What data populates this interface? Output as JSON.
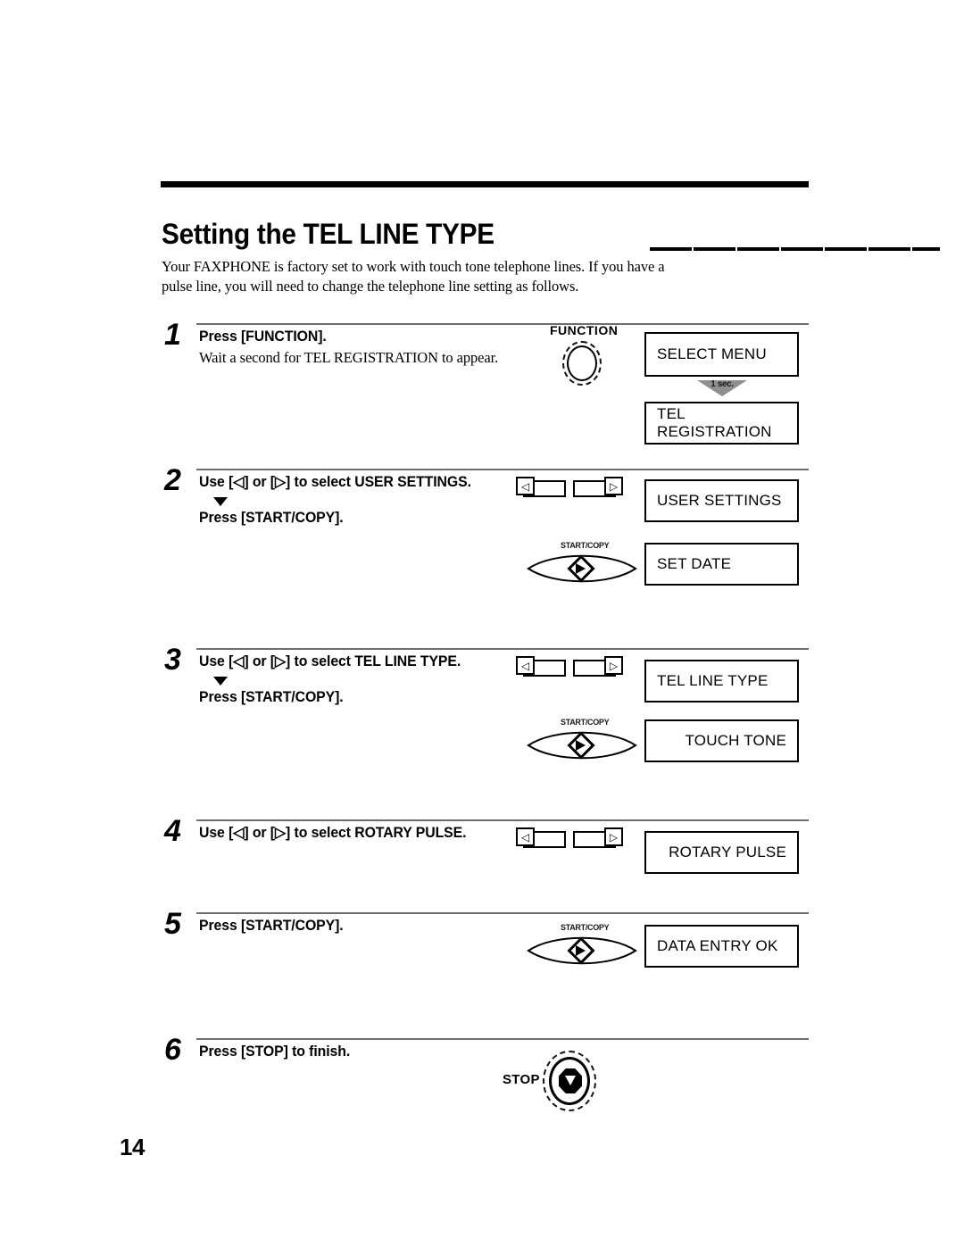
{
  "document": {
    "title": "Setting the TEL LINE TYPE",
    "intro_lines": [
      "Your FAXPHONE is factory set to work with touch tone telephone lines. If you have a",
      "pulse line, you will need to change the telephone line setting as follows."
    ],
    "page_number": "14"
  },
  "labels": {
    "function_key": "FUNCTION",
    "start_copy_key": "START/COPY",
    "stop_key": "STOP",
    "left_arrow_glyph": "◁",
    "right_arrow_glyph": "▷",
    "one_second": "1 sec."
  },
  "steps": [
    {
      "number": "1",
      "lines": [
        {
          "style": "bold",
          "text": "Press [FUNCTION]."
        },
        {
          "style": "serif",
          "text": "Wait a second for TEL REGISTRATION to appear."
        }
      ],
      "key_graphic": "function-key",
      "displays": [
        {
          "text": "SELECT MENU",
          "align": "left"
        },
        {
          "text": "TEL REGISTRATION",
          "align": "left"
        }
      ],
      "transition": "1 sec."
    },
    {
      "number": "2",
      "lines": [
        {
          "style": "bold",
          "text": "Use [◁] or [▷] to select USER SETTINGS."
        },
        {
          "style": "arrow",
          "text": ""
        },
        {
          "style": "bold",
          "text": "Press [START/COPY]."
        }
      ],
      "key_graphics": [
        "arrow-keys",
        "start-copy-key"
      ],
      "displays": [
        {
          "text": "USER SETTINGS",
          "align": "left"
        },
        {
          "text": "SET DATE",
          "align": "left"
        }
      ]
    },
    {
      "number": "3",
      "lines": [
        {
          "style": "bold",
          "text": "Use [◁] or [▷] to select TEL LINE TYPE."
        },
        {
          "style": "arrow",
          "text": ""
        },
        {
          "style": "bold",
          "text": "Press [START/COPY]."
        }
      ],
      "key_graphics": [
        "arrow-keys",
        "start-copy-key"
      ],
      "displays": [
        {
          "text": "TEL LINE TYPE",
          "align": "left"
        },
        {
          "text": "TOUCH TONE",
          "align": "right"
        }
      ]
    },
    {
      "number": "4",
      "lines": [
        {
          "style": "bold",
          "text": "Use [◁] or [▷] to select ROTARY PULSE."
        }
      ],
      "key_graphics": [
        "arrow-keys"
      ],
      "displays": [
        {
          "text": "ROTARY PULSE",
          "align": "right"
        }
      ]
    },
    {
      "number": "5",
      "lines": [
        {
          "style": "bold",
          "text": "Press [START/COPY]."
        }
      ],
      "key_graphics": [
        "start-copy-key"
      ],
      "displays": [
        {
          "text": "DATA ENTRY OK",
          "align": "left"
        }
      ]
    },
    {
      "number": "6",
      "lines": [
        {
          "style": "bold",
          "text": "Press [STOP] to finish."
        }
      ],
      "key_graphics": [
        "stop-key"
      ],
      "displays": []
    }
  ]
}
